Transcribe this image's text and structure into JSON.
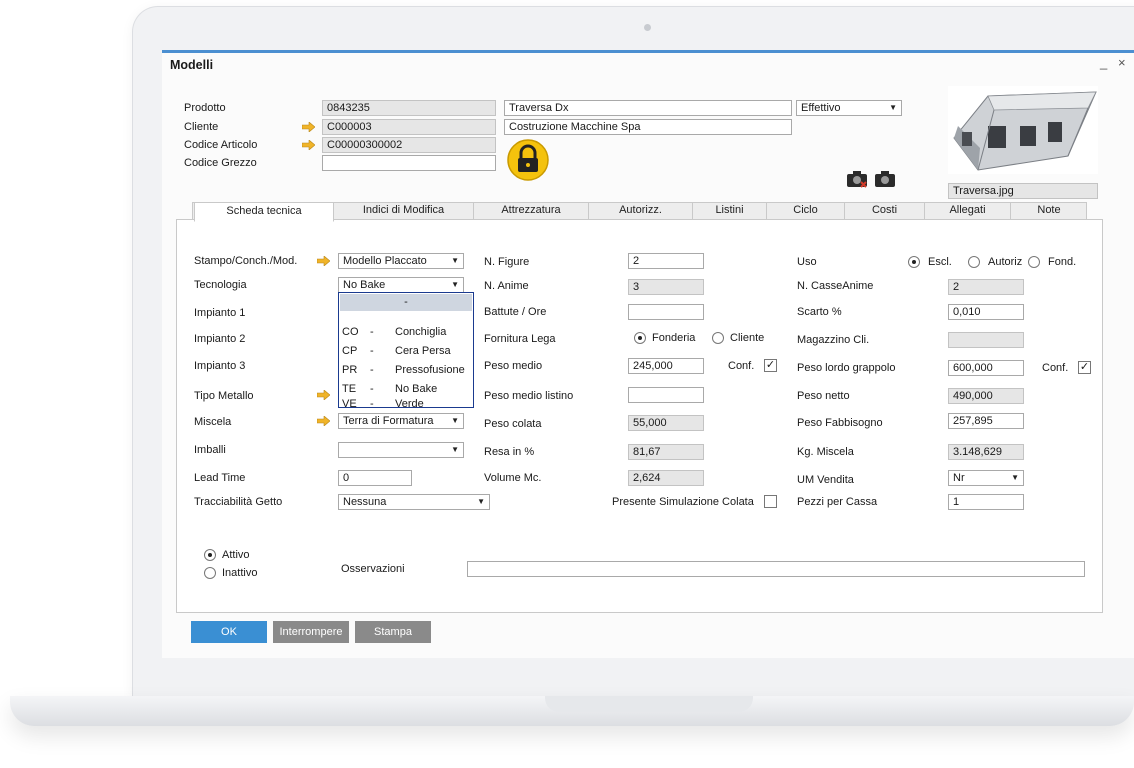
{
  "window": {
    "title": "Modelli",
    "minimize": "_",
    "close": "×"
  },
  "header": {
    "prodotto_label": "Prodotto",
    "prodotto_code": "0843235",
    "prodotto_desc": "Traversa Dx",
    "status_value": "Effettivo",
    "cliente_label": "Cliente",
    "cliente_code": "C000003",
    "cliente_name": "Costruzione Macchine Spa",
    "codice_articolo_label": "Codice Articolo",
    "codice_articolo_value": "C00000300002",
    "codice_grezzo_label": "Codice Grezzo",
    "codice_grezzo_value": "",
    "image_filename": "Traversa.jpg"
  },
  "tabs": [
    "Scheda tecnica",
    "Indici di Modifica",
    "Attrezzatura",
    "Autorizz.",
    "Listini",
    "Ciclo",
    "Costi",
    "Allegati",
    "Note"
  ],
  "left": {
    "stampo_label": "Stampo/Conch./Mod.",
    "stampo_value": "Modello Placcato",
    "tecnologia_label": "Tecnologia",
    "tecnologia_value": "No Bake",
    "impianto1_label": "Impianto 1",
    "impianto2_label": "Impianto 2",
    "impianto3_label": "Impianto 3",
    "tipo_metallo_label": "Tipo Metallo",
    "miscela_label": "Miscela",
    "miscela_value": "Terra di Formatura",
    "imballi_label": "Imballi",
    "imballi_value": "",
    "lead_time_label": "Lead Time",
    "lead_time_value": "0",
    "tracciabilita_label": "Tracciabilità Getto",
    "tracciabilita_value": "Nessuna"
  },
  "dropdown": {
    "selected": "-",
    "options": [
      {
        "code": "CO",
        "sep": "-",
        "label": "Conchiglia"
      },
      {
        "code": "CP",
        "sep": "-",
        "label": "Cera Persa"
      },
      {
        "code": "PR",
        "sep": "-",
        "label": "Pressofusione"
      },
      {
        "code": "TE",
        "sep": "-",
        "label": "No Bake"
      },
      {
        "code": "VE",
        "sep": "-",
        "label": "Verde"
      }
    ]
  },
  "middle": {
    "n_figure_label": "N. Figure",
    "n_figure_value": "2",
    "n_anime_label": "N. Anime",
    "n_anime_value": "3",
    "battute_label": "Battute / Ore",
    "battute_value": "",
    "fornitura_label": "Fornitura Lega",
    "fonderia_label": "Fonderia",
    "cliente_label": "Cliente",
    "peso_medio_label": "Peso medio",
    "peso_medio_value": "245,000",
    "conf_label": "Conf.",
    "peso_medio_listino_label": "Peso medio listino",
    "peso_medio_listino_value": "",
    "peso_colata_label": "Peso colata",
    "peso_colata_value": "55,000",
    "resa_label": "Resa in %",
    "resa_value": "81,67",
    "volume_label": "Volume Mc.",
    "volume_value": "2,624",
    "simulazione_label": "Presente Simulazione Colata"
  },
  "right": {
    "uso_label": "Uso",
    "uso_opt1": "Escl.",
    "uso_opt2": "Autoriz",
    "uso_opt3": "Fond.",
    "n_casse_label": "N. CasseAnime",
    "n_casse_value": "2",
    "scarto_label": "Scarto %",
    "scarto_value": "0,010",
    "magazzino_label": "Magazzino Cli.",
    "magazzino_value": "",
    "peso_lordo_label": "Peso lordo grappolo",
    "peso_lordo_value": "600,000",
    "conf_label": "Conf.",
    "peso_netto_label": "Peso netto",
    "peso_netto_value": "490,000",
    "peso_fabb_label": "Peso Fabbisogno",
    "peso_fabb_value": "257,895",
    "kg_miscela_label": "Kg. Miscela",
    "kg_miscela_value": "3.148,629",
    "um_vendita_label": "UM Vendita",
    "um_vendita_value": "Nr",
    "pezzi_cassa_label": "Pezzi per Cassa",
    "pezzi_cassa_value": "1"
  },
  "bottom": {
    "attivo_label": "Attivo",
    "inattivo_label": "Inattivo",
    "osservazioni_label": "Osservazioni",
    "osservazioni_value": ""
  },
  "buttons": {
    "ok": "OK",
    "interrompere": "Interrompere",
    "stampa": "Stampa"
  },
  "colors": {
    "accent": "#3a8fd3",
    "arrow": "#f0b429",
    "topbar": "#4b8fd1"
  }
}
